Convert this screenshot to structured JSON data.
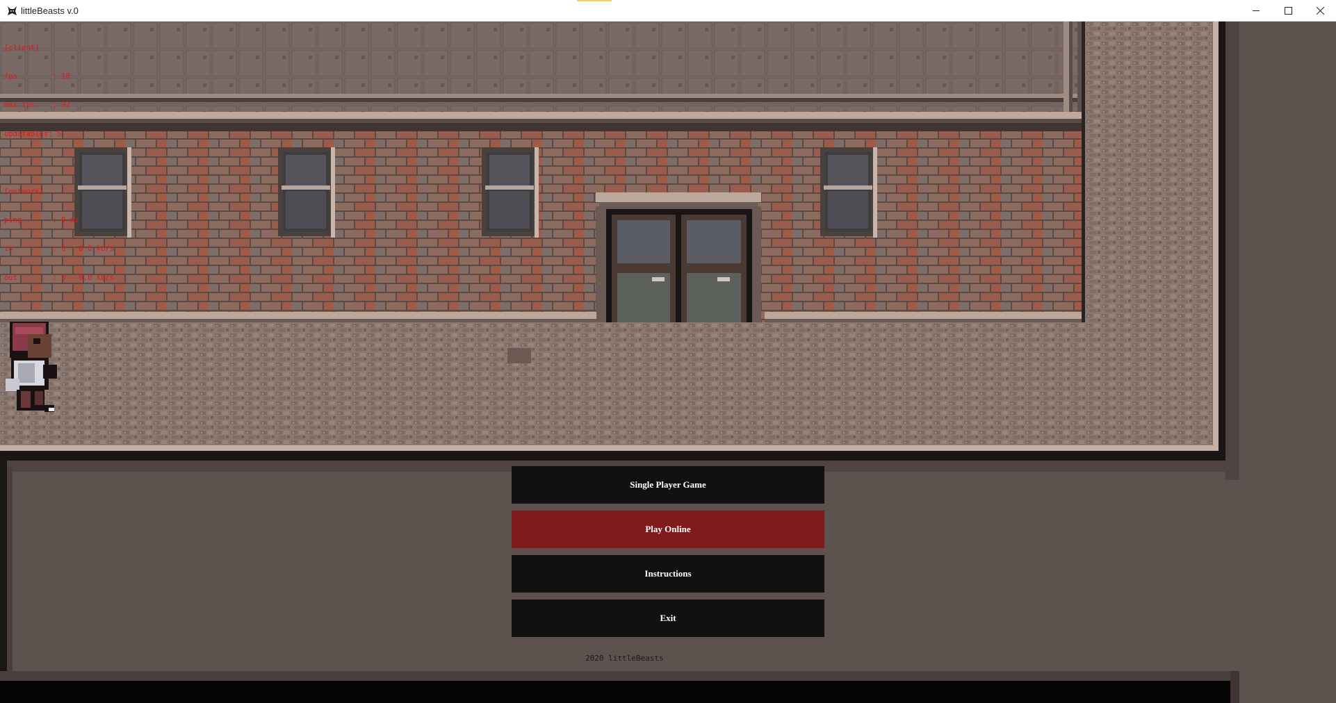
{
  "window": {
    "title": "littleBeasts v.0"
  },
  "debug": {
    "lines": [
      "[client]",
      "fps        : 10",
      "max fps    : 92",
      "updatables: 5",
      "",
      "[network]",
      "ping       : 0 ms",
      "in         : 0 - 0.0 kb/s",
      "out        : 0 - 0.0 kb/s"
    ]
  },
  "menu": {
    "single_player": "Single Player Game",
    "play_online": "Play Online",
    "instructions": "Instructions",
    "exit": "Exit",
    "selected": "Play Online"
  },
  "footer": {
    "copyright": "2020 littleBeasts"
  },
  "colors": {
    "selected_button": "#811b1b",
    "button": "#131110",
    "debug_text": "#e01818"
  }
}
